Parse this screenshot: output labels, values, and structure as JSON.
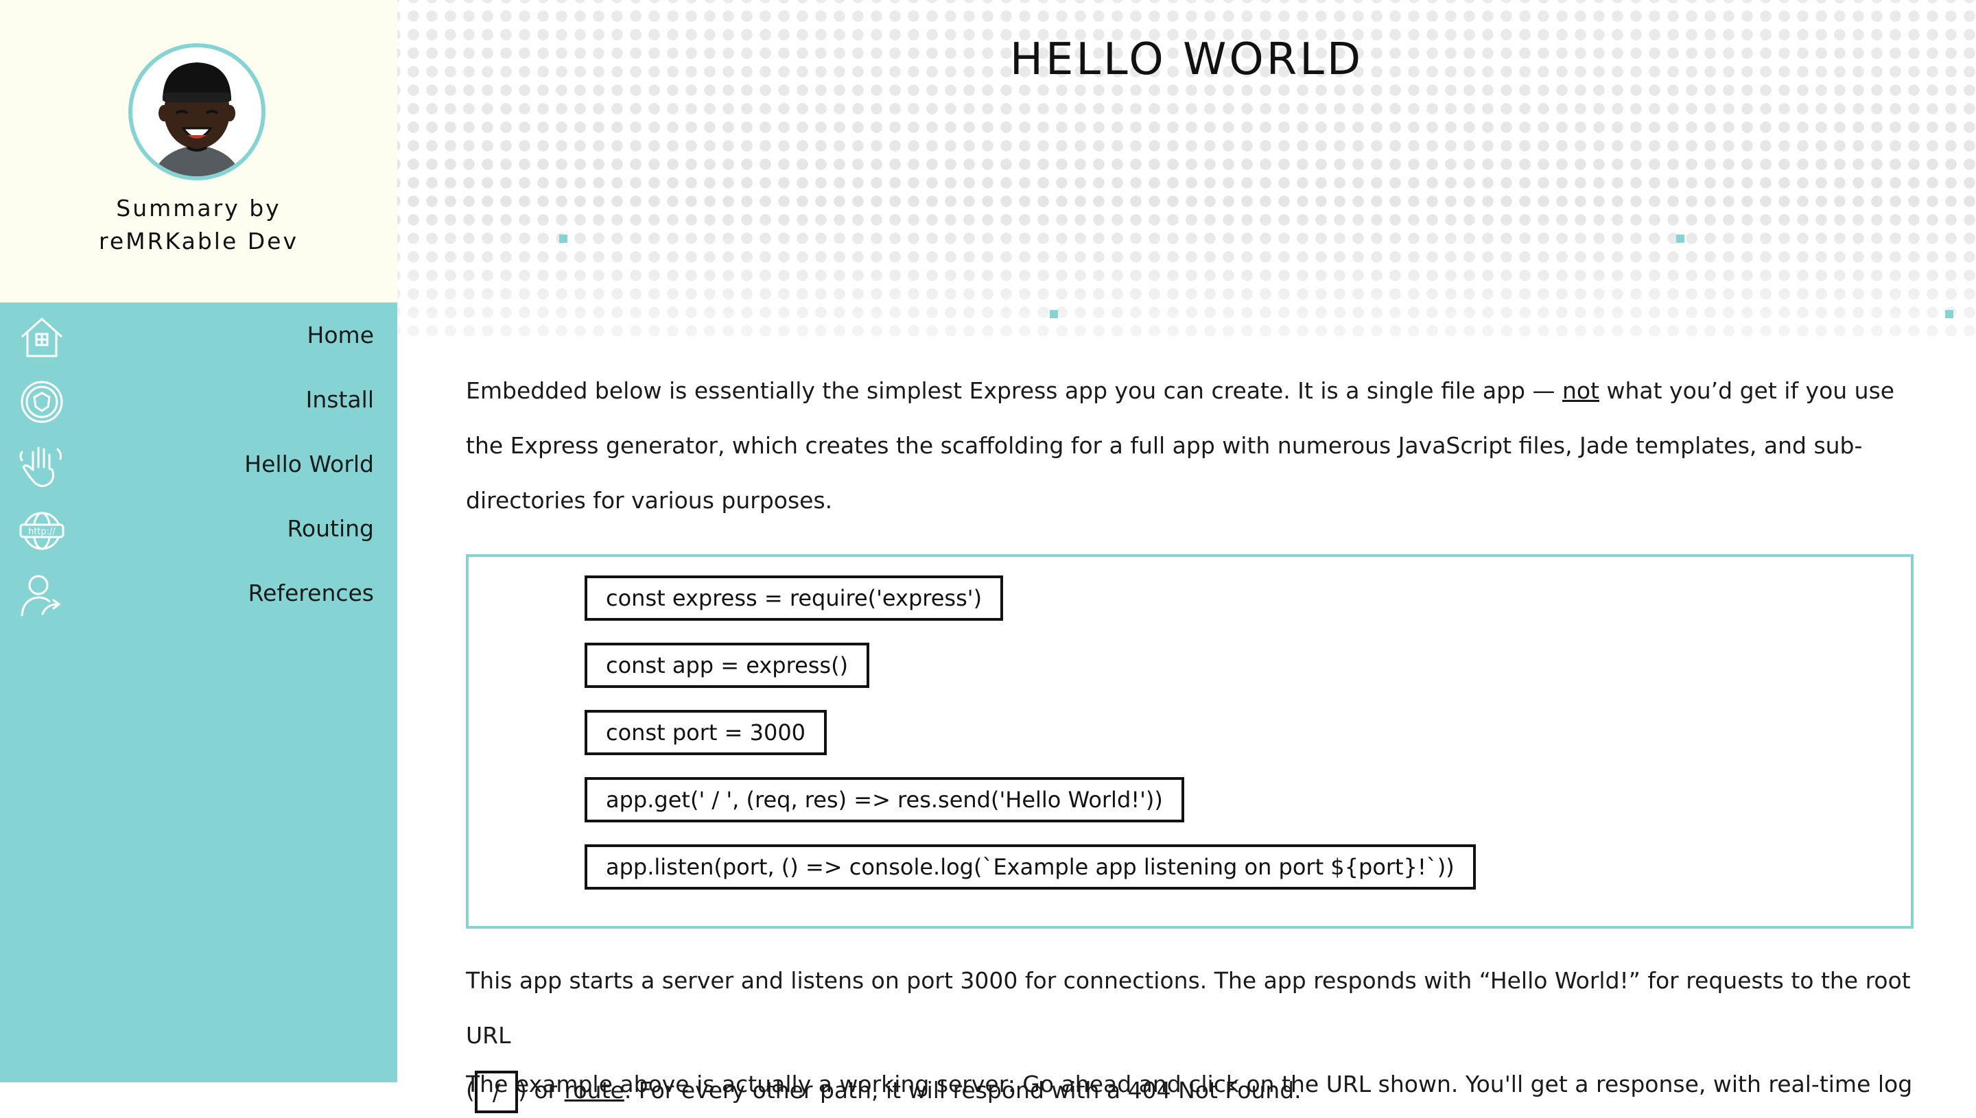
{
  "sidebar": {
    "profile_name_line1": "Summary by",
    "profile_name_line2": "reMRKable Dev",
    "items": [
      {
        "label": "Home",
        "icon": "house-icon"
      },
      {
        "label": "Install",
        "icon": "shield-icon"
      },
      {
        "label": "Hello World",
        "icon": "hand-wave-icon"
      },
      {
        "label": "Routing",
        "icon": "http-globe-icon"
      },
      {
        "label": "References",
        "icon": "user-share-icon"
      }
    ]
  },
  "colors": {
    "accent": "#86d3d3",
    "profile_bg": "#fdfdf0",
    "text": "#111111"
  },
  "main": {
    "title": "HELLO WORLD",
    "intro_before_link": "Embedded below is essentially the simplest Express app you can create. It is a single file app — ",
    "intro_link": "not",
    "intro_after_link": " what you’d get if you use the Express generator, which creates the scaffolding for a full app with numerous JavaScript files, Jade templates, and sub-directories for various purposes.",
    "code_lines": [
      "const express = require('express')",
      "const app = express()",
      "const port = 3000",
      "app.get(' / ', (req, res) => res.send('Hello World!'))",
      "app.listen(port, () => console.log(`Example app listening on port ${port}!`))"
    ],
    "after_line1": "This app starts a server and listens on port 3000 for connections. The app responds with “Hello World!” for requests to the root URL",
    "after_paren_open": "(",
    "after_inline_code": "/",
    "after_paren_close": ") or ",
    "after_link": "route",
    "after_rest": ". For every other path, it will respond with a 404 Not Found.",
    "cut_text": "The example above is actually a working server: Go ahead and click on the URL shown. You'll get a response, with real-time logs on"
  }
}
